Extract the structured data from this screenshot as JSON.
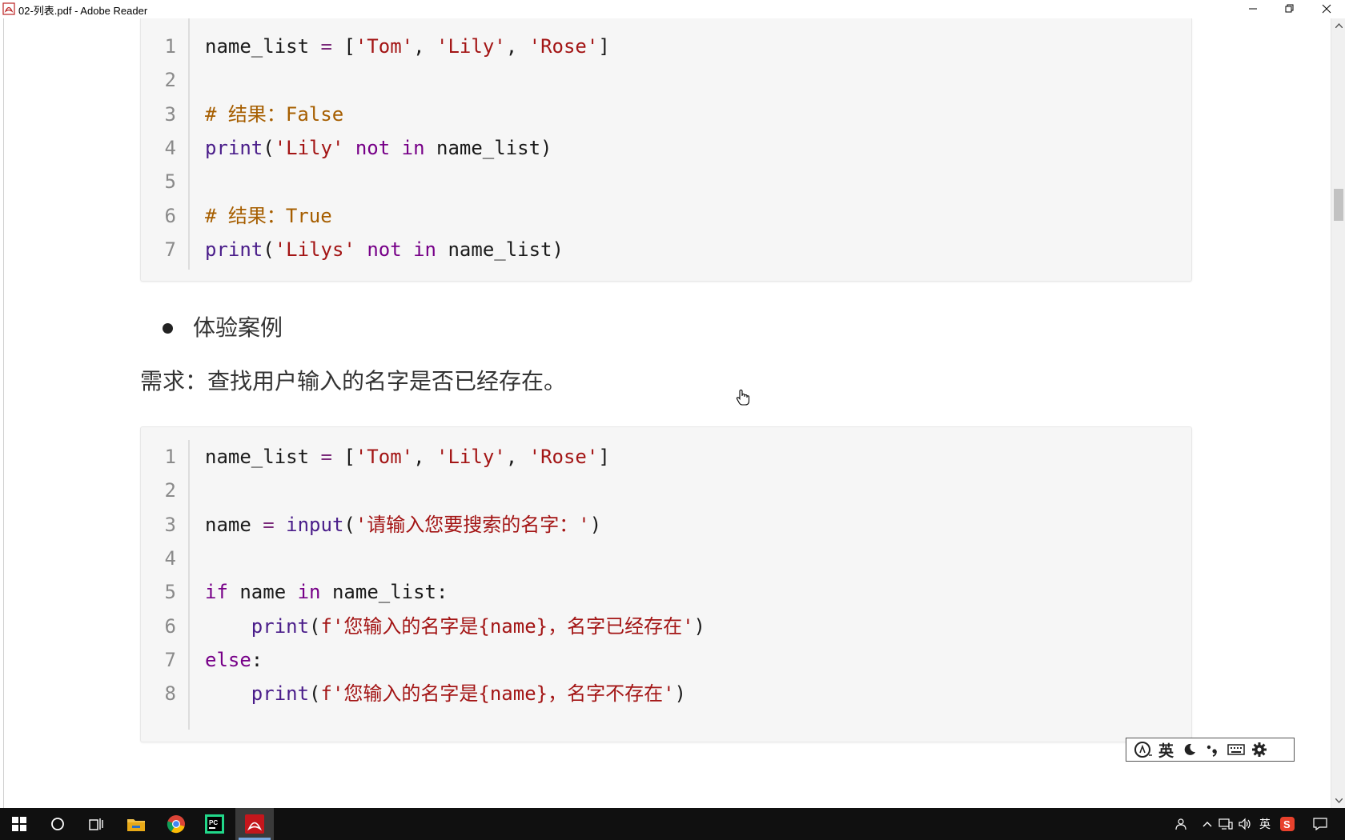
{
  "window": {
    "title": "02-列表.pdf - Adobe Reader"
  },
  "code_block_1": {
    "lines": [
      {
        "n": "1",
        "tokens": [
          [
            "t",
            "name_list "
          ],
          [
            "o",
            "= "
          ],
          [
            "t",
            "["
          ],
          [
            "s",
            "'Tom'"
          ],
          [
            "t",
            ", "
          ],
          [
            "s",
            "'Lily'"
          ],
          [
            "t",
            ", "
          ],
          [
            "s",
            "'Rose'"
          ],
          [
            "t",
            "]"
          ]
        ]
      },
      {
        "n": "2",
        "tokens": []
      },
      {
        "n": "3",
        "tokens": [
          [
            "c",
            "# 结果：False"
          ]
        ]
      },
      {
        "n": "4",
        "tokens": [
          [
            "f",
            "print"
          ],
          [
            "t",
            "("
          ],
          [
            "s",
            "'Lily'"
          ],
          [
            "t",
            " "
          ],
          [
            "k",
            "not in"
          ],
          [
            "t",
            " name_list)"
          ]
        ]
      },
      {
        "n": "5",
        "tokens": []
      },
      {
        "n": "6",
        "tokens": [
          [
            "c",
            "# 结果：True"
          ]
        ]
      },
      {
        "n": "7",
        "tokens": [
          [
            "f",
            "print"
          ],
          [
            "t",
            "("
          ],
          [
            "s",
            "'Lilys'"
          ],
          [
            "t",
            " "
          ],
          [
            "k",
            "not in"
          ],
          [
            "t",
            " name_list)"
          ]
        ]
      }
    ]
  },
  "bullet": "体验案例",
  "requirement": "需求：查找用户输入的名字是否已经存在。",
  "code_block_2": {
    "lines": [
      {
        "n": "1",
        "tokens": [
          [
            "t",
            "name_list "
          ],
          [
            "o",
            "= "
          ],
          [
            "t",
            "["
          ],
          [
            "s",
            "'Tom'"
          ],
          [
            "t",
            ", "
          ],
          [
            "s",
            "'Lily'"
          ],
          [
            "t",
            ", "
          ],
          [
            "s",
            "'Rose'"
          ],
          [
            "t",
            "]"
          ]
        ]
      },
      {
        "n": "2",
        "tokens": []
      },
      {
        "n": "3",
        "tokens": [
          [
            "t",
            "name "
          ],
          [
            "o",
            "= "
          ],
          [
            "f",
            "input"
          ],
          [
            "t",
            "("
          ],
          [
            "s",
            "'请输入您要搜索的名字：'"
          ],
          [
            "t",
            ")"
          ]
        ]
      },
      {
        "n": "4",
        "tokens": []
      },
      {
        "n": "5",
        "tokens": [
          [
            "k",
            "if"
          ],
          [
            "t",
            " name "
          ],
          [
            "k",
            "in"
          ],
          [
            "t",
            " name_list:"
          ]
        ]
      },
      {
        "n": "6",
        "tokens": [
          [
            "t",
            "    "
          ],
          [
            "f",
            "print"
          ],
          [
            "t",
            "("
          ],
          [
            "s",
            "f'您输入的名字是{name}，名字已经存在'"
          ],
          [
            "t",
            ")"
          ]
        ]
      },
      {
        "n": "7",
        "tokens": [
          [
            "k",
            "else"
          ],
          [
            "t",
            ":"
          ]
        ]
      },
      {
        "n": "8",
        "tokens": [
          [
            "t",
            "    "
          ],
          [
            "f",
            "print"
          ],
          [
            "t",
            "("
          ],
          [
            "s",
            "f'您输入的名字是{name}，名字不存在'"
          ],
          [
            "t",
            ")"
          ]
        ]
      }
    ]
  },
  "ime_toolbar": {
    "items": [
      {
        "name": "ime-logo-icon",
        "text": ""
      },
      {
        "name": "ime-language-toggle",
        "text": "英"
      },
      {
        "name": "ime-moon-icon",
        "text": ""
      },
      {
        "name": "ime-punctuation-icon",
        "text": ""
      },
      {
        "name": "ime-keyboard-icon",
        "text": ""
      },
      {
        "name": "ime-settings-icon",
        "text": ""
      }
    ]
  },
  "taskbar": {
    "apps": [
      "windows-start-icon",
      "cortana-search-icon",
      "task-view-icon",
      "file-explorer-icon",
      "chrome-icon",
      "pycharm-icon",
      "adobe-reader-icon"
    ],
    "tray_lang": "英"
  },
  "colors": {
    "string": "#a31515",
    "keyword": "#770088",
    "comment": "#a65e00",
    "function": "#4a1d8a",
    "code_bg": "#f6f6f6",
    "taskbar_bg": "#101010"
  }
}
